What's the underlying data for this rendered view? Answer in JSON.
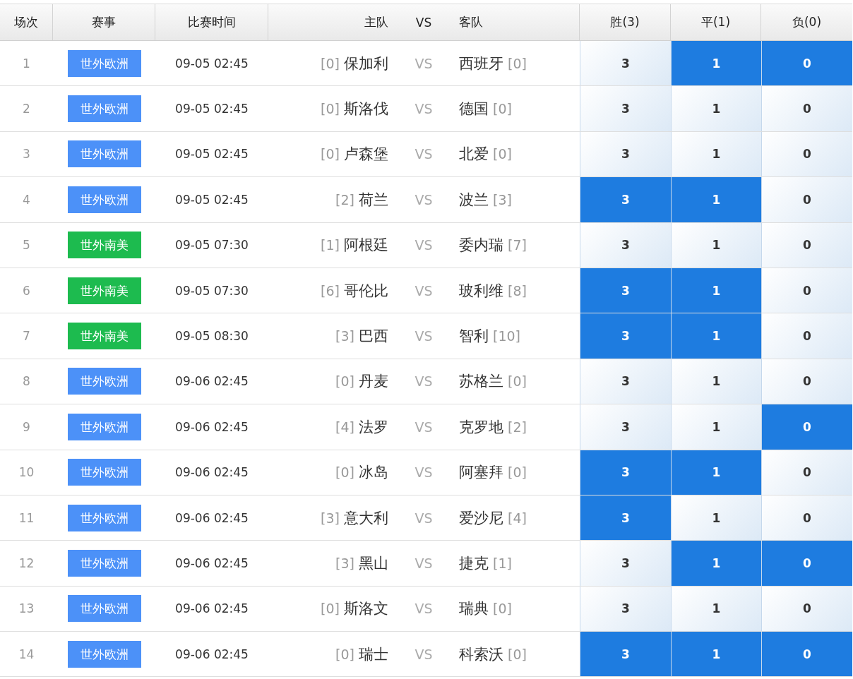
{
  "columns": [
    "场次",
    "赛事",
    "比赛时间",
    "主队",
    "VS",
    "客队",
    "胜(3)",
    "平(1)",
    "负(0)"
  ],
  "rows": [
    {
      "no": "1",
      "league": {
        "label": "世外欧洲",
        "color": "#4c91f8"
      },
      "time": "09-05 02:45",
      "home": {
        "rank": "[0]",
        "name": "保加利"
      },
      "vs": "VS",
      "away": {
        "name": "西班牙",
        "rank": "[0]"
      },
      "options": [
        {
          "value": "3",
          "selected": false
        },
        {
          "value": "1",
          "selected": true
        },
        {
          "value": "0",
          "selected": true
        }
      ]
    },
    {
      "no": "2",
      "league": {
        "label": "世外欧洲",
        "color": "#4c91f8"
      },
      "time": "09-05 02:45",
      "home": {
        "rank": "[0]",
        "name": "斯洛伐"
      },
      "vs": "VS",
      "away": {
        "name": "德国",
        "rank": "[0]"
      },
      "options": [
        {
          "value": "3",
          "selected": false
        },
        {
          "value": "1",
          "selected": false
        },
        {
          "value": "0",
          "selected": false
        }
      ]
    },
    {
      "no": "3",
      "league": {
        "label": "世外欧洲",
        "color": "#4c91f8"
      },
      "time": "09-05 02:45",
      "home": {
        "rank": "[0]",
        "name": "卢森堡"
      },
      "vs": "VS",
      "away": {
        "name": "北爱",
        "rank": "[0]"
      },
      "options": [
        {
          "value": "3",
          "selected": false
        },
        {
          "value": "1",
          "selected": false
        },
        {
          "value": "0",
          "selected": false
        }
      ]
    },
    {
      "no": "4",
      "league": {
        "label": "世外欧洲",
        "color": "#4c91f8"
      },
      "time": "09-05 02:45",
      "home": {
        "rank": "[2]",
        "name": "荷兰"
      },
      "vs": "VS",
      "away": {
        "name": "波兰",
        "rank": "[3]"
      },
      "options": [
        {
          "value": "3",
          "selected": true
        },
        {
          "value": "1",
          "selected": true
        },
        {
          "value": "0",
          "selected": false
        }
      ]
    },
    {
      "no": "5",
      "league": {
        "label": "世外南美",
        "color": "#1dbb4f"
      },
      "time": "09-05 07:30",
      "home": {
        "rank": "[1]",
        "name": "阿根廷"
      },
      "vs": "VS",
      "away": {
        "name": "委内瑞",
        "rank": "[7]"
      },
      "options": [
        {
          "value": "3",
          "selected": false
        },
        {
          "value": "1",
          "selected": false
        },
        {
          "value": "0",
          "selected": false
        }
      ]
    },
    {
      "no": "6",
      "league": {
        "label": "世外南美",
        "color": "#1dbb4f"
      },
      "time": "09-05 07:30",
      "home": {
        "rank": "[6]",
        "name": "哥伦比"
      },
      "vs": "VS",
      "away": {
        "name": "玻利维",
        "rank": "[8]"
      },
      "options": [
        {
          "value": "3",
          "selected": true
        },
        {
          "value": "1",
          "selected": true
        },
        {
          "value": "0",
          "selected": false
        }
      ]
    },
    {
      "no": "7",
      "league": {
        "label": "世外南美",
        "color": "#1dbb4f"
      },
      "time": "09-05 08:30",
      "home": {
        "rank": "[3]",
        "name": "巴西"
      },
      "vs": "VS",
      "away": {
        "name": "智利",
        "rank": "[10]"
      },
      "options": [
        {
          "value": "3",
          "selected": true
        },
        {
          "value": "1",
          "selected": true
        },
        {
          "value": "0",
          "selected": false
        }
      ]
    },
    {
      "no": "8",
      "league": {
        "label": "世外欧洲",
        "color": "#4c91f8"
      },
      "time": "09-06 02:45",
      "home": {
        "rank": "[0]",
        "name": "丹麦"
      },
      "vs": "VS",
      "away": {
        "name": "苏格兰",
        "rank": "[0]"
      },
      "options": [
        {
          "value": "3",
          "selected": false
        },
        {
          "value": "1",
          "selected": false
        },
        {
          "value": "0",
          "selected": false
        }
      ]
    },
    {
      "no": "9",
      "league": {
        "label": "世外欧洲",
        "color": "#4c91f8"
      },
      "time": "09-06 02:45",
      "home": {
        "rank": "[4]",
        "name": "法罗"
      },
      "vs": "VS",
      "away": {
        "name": "克罗地",
        "rank": "[2]"
      },
      "options": [
        {
          "value": "3",
          "selected": false
        },
        {
          "value": "1",
          "selected": false
        },
        {
          "value": "0",
          "selected": true
        }
      ]
    },
    {
      "no": "10",
      "league": {
        "label": "世外欧洲",
        "color": "#4c91f8"
      },
      "time": "09-06 02:45",
      "home": {
        "rank": "[0]",
        "name": "冰岛"
      },
      "vs": "VS",
      "away": {
        "name": "阿塞拜",
        "rank": "[0]"
      },
      "options": [
        {
          "value": "3",
          "selected": true
        },
        {
          "value": "1",
          "selected": true
        },
        {
          "value": "0",
          "selected": false
        }
      ]
    },
    {
      "no": "11",
      "league": {
        "label": "世外欧洲",
        "color": "#4c91f8"
      },
      "time": "09-06 02:45",
      "home": {
        "rank": "[3]",
        "name": "意大利"
      },
      "vs": "VS",
      "away": {
        "name": "爱沙尼",
        "rank": "[4]"
      },
      "options": [
        {
          "value": "3",
          "selected": true
        },
        {
          "value": "1",
          "selected": false
        },
        {
          "value": "0",
          "selected": false
        }
      ]
    },
    {
      "no": "12",
      "league": {
        "label": "世外欧洲",
        "color": "#4c91f8"
      },
      "time": "09-06 02:45",
      "home": {
        "rank": "[3]",
        "name": "黑山"
      },
      "vs": "VS",
      "away": {
        "name": "捷克",
        "rank": "[1]"
      },
      "options": [
        {
          "value": "3",
          "selected": false
        },
        {
          "value": "1",
          "selected": true
        },
        {
          "value": "0",
          "selected": true
        }
      ]
    },
    {
      "no": "13",
      "league": {
        "label": "世外欧洲",
        "color": "#4c91f8"
      },
      "time": "09-06 02:45",
      "home": {
        "rank": "[0]",
        "name": "斯洛文"
      },
      "vs": "VS",
      "away": {
        "name": "瑞典",
        "rank": "[0]"
      },
      "options": [
        {
          "value": "3",
          "selected": false
        },
        {
          "value": "1",
          "selected": false
        },
        {
          "value": "0",
          "selected": false
        }
      ]
    },
    {
      "no": "14",
      "league": {
        "label": "世外欧洲",
        "color": "#4c91f8"
      },
      "time": "09-06 02:45",
      "home": {
        "rank": "[0]",
        "name": "瑞士"
      },
      "vs": "VS",
      "away": {
        "name": "科索沃",
        "rank": "[0]"
      },
      "options": [
        {
          "value": "3",
          "selected": true
        },
        {
          "value": "1",
          "selected": true
        },
        {
          "value": "0",
          "selected": true
        }
      ]
    }
  ]
}
